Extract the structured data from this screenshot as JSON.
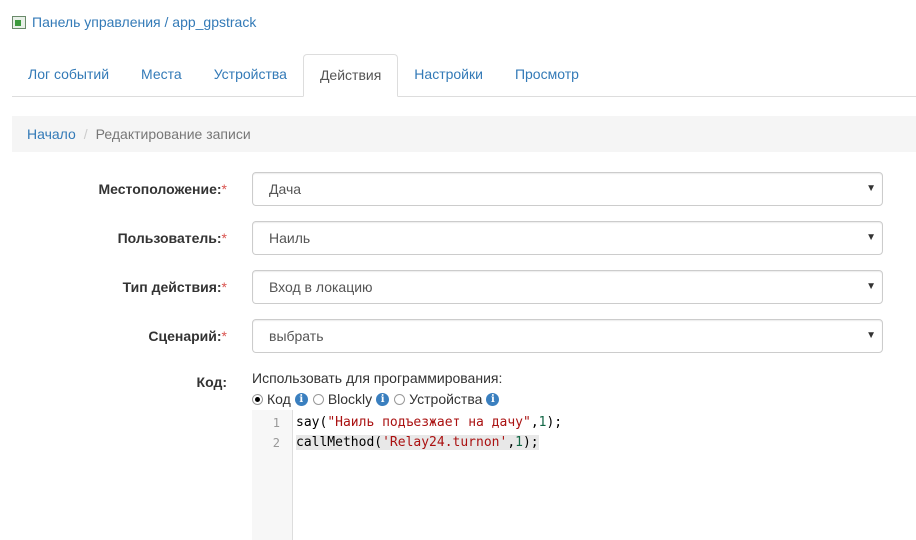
{
  "header": {
    "title": "Панель управления / app_gpstrack"
  },
  "tabs": [
    {
      "label": "Лог событий"
    },
    {
      "label": "Места"
    },
    {
      "label": "Устройства"
    },
    {
      "label": "Действия"
    },
    {
      "label": "Настройки"
    },
    {
      "label": "Просмотр"
    }
  ],
  "active_tab": "Действия",
  "breadcrumb": {
    "home": "Начало",
    "separator": "/",
    "current": "Редактирование записи"
  },
  "form": {
    "location": {
      "label": "Местоположение:",
      "required": "*",
      "value": "Дача"
    },
    "user": {
      "label": "Пользователь:",
      "required": "*",
      "value": "Наиль"
    },
    "action_type": {
      "label": "Тип действия:",
      "required": "*",
      "value": "Вход в локацию"
    },
    "scenario": {
      "label": "Сценарий:",
      "required": "*",
      "value": "выбрать"
    },
    "code": {
      "label": "Код:",
      "use_for": "Использовать для программирования:",
      "options": [
        "Код",
        "Blockly",
        "Устройства"
      ],
      "selected": "Код",
      "lines": [
        {
          "num": "1",
          "parts": [
            "say(",
            "\"Наиль подъезжает на дачу\"",
            ",",
            "1",
            ");"
          ]
        },
        {
          "num": "2",
          "parts": [
            "callMethod(",
            "'Relay24.turnon'",
            ",",
            "1",
            ");"
          ]
        }
      ]
    }
  },
  "colors": {
    "link": "#337ab7",
    "required": "#d9534f",
    "info_icon": "#3a7fbf"
  }
}
